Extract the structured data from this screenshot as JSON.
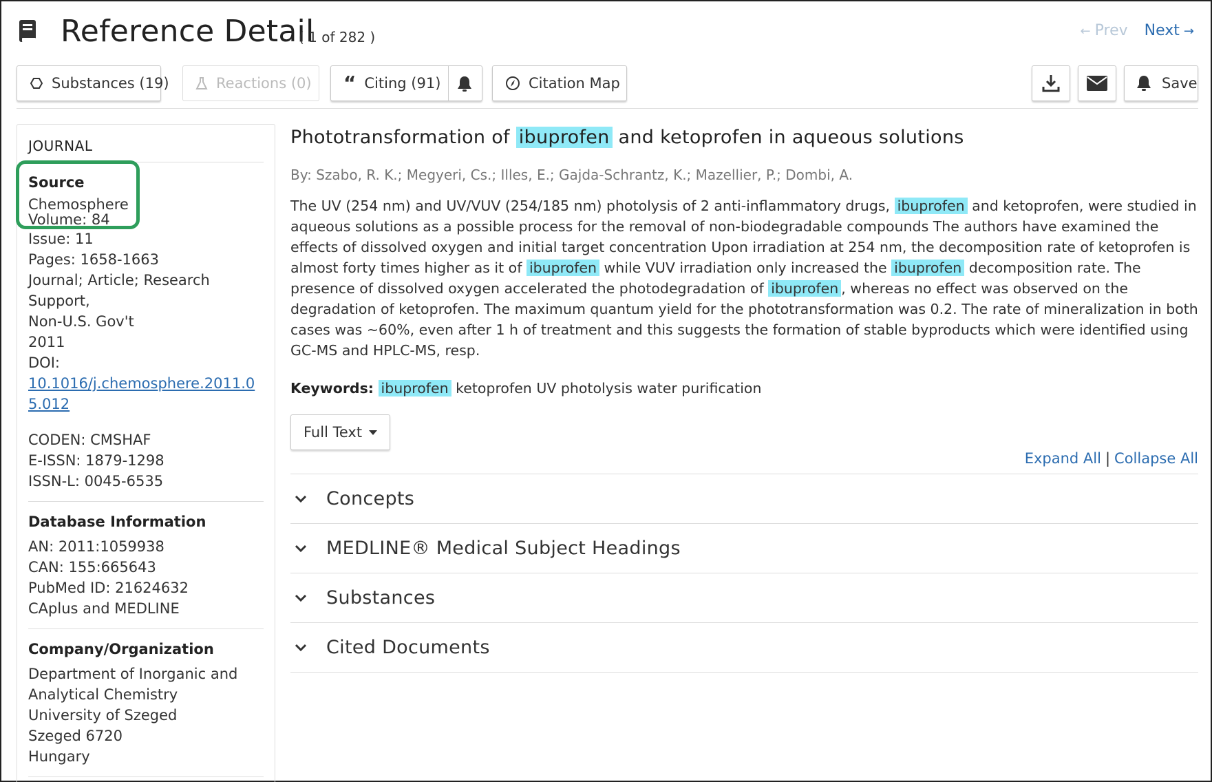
{
  "header": {
    "title": "Reference Detail",
    "count": "( 1 of 282 )",
    "prev_label": "Prev",
    "next_label": "Next"
  },
  "toolbar": {
    "substances_label": "Substances (19)",
    "reactions_label": "Reactions (0)",
    "citing_label": "Citing (91)",
    "citation_map_label": "Citation Map",
    "save_label": "Save"
  },
  "sidebar": {
    "heading": "JOURNAL",
    "source_label": "Source",
    "source_value": "Chemosphere",
    "volume": "Volume: 84",
    "issue": "Issue: 11",
    "pages": "Pages: 1658-1663",
    "doc_type_1": "Journal; Article; Research Support,",
    "doc_type_2": "Non-U.S. Gov't",
    "year": "2011",
    "doi_label": "DOI:",
    "doi_value": "10.1016/j.chemosphere.2011.05.012",
    "coden": "CODEN: CMSHAF",
    "eissn": "E-ISSN: 1879-1298",
    "issnl": "ISSN-L: 0045-6535",
    "db_label": "Database Information",
    "an": "AN: 2011:1059938",
    "can": "CAN: 155:665643",
    "pubmed": "PubMed ID: 21624632",
    "db_sources": "CAplus and MEDLINE",
    "org_label": "Company/Organization",
    "org_1": "Department of Inorganic and",
    "org_2": "Analytical Chemistry",
    "org_3": "University of Szeged",
    "org_4": "Szeged 6720",
    "org_5": "Hungary"
  },
  "article": {
    "title_pre": "Phototransformation of ",
    "title_hl": "ibuprofen",
    "title_post": " and ketoprofen in aqueous solutions",
    "authors": "By: Szabo, R. K.; Megyeri, Cs.; Illes, E.; Gajda-Schrantz, K.; Mazellier, P.; Dombi, A.",
    "abs_1": "The UV (254 nm) and UV/VUV (254/185 nm) photolysis of 2 anti-inflammatory drugs, ",
    "abs_hl_1": "ibuprofen",
    "abs_2": " and ketoprofen, were studied in aqueous solutions as a possible process for the removal of non-biodegradable compounds The authors have examined the effects of dissolved oxygen and initial target concentration Upon irradiation at 254 nm, the decomposition rate of ketoprofen is almost forty times higher as it of ",
    "abs_hl_2": "ibuprofen",
    "abs_3": " while VUV irradiation only increased the ",
    "abs_hl_3": "ibuprofen",
    "abs_4": " decomposition rate. The presence of dissolved oxygen accelerated the photodegradation of ",
    "abs_hl_4": "ibuprofen",
    "abs_5": ", whereas no effect was observed on the degradation of ketoprofen. The maximum quantum yield for the phototransformation was 0.2. The rate of mineralization in both cases was ~60%, even after 1 h of treatment and this suggests the formation of stable byproducts which were identified using GC-MS and HPLC-MS, resp.",
    "keywords_label": "Keywords:",
    "keywords_hl": "ibuprofen",
    "keywords_rest": " ketoprofen UV photolysis water purification",
    "full_text_label": "Full Text",
    "expand_all": "Expand All",
    "separator": "|",
    "collapse_all": "Collapse All"
  },
  "accordion": [
    {
      "label": "Concepts"
    },
    {
      "label": "MEDLINE® Medical Subject Headings"
    },
    {
      "label": "Substances"
    },
    {
      "label": "Cited Documents"
    }
  ],
  "colors": {
    "link": "#2b6cb0",
    "highlight": "#8fe9f7",
    "source_box": "#2e9e5b"
  }
}
